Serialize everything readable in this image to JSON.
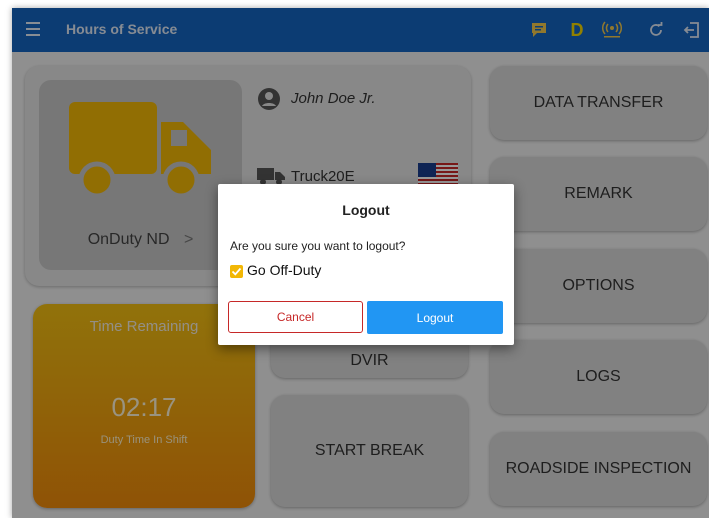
{
  "app": {
    "title": "Hours of Service"
  },
  "topbar_icons": [
    "menu-icon",
    "message-icon",
    "driving-status-icon",
    "eld-connection-icon",
    "refresh-icon",
    "logout-icon"
  ],
  "topbar": {
    "status_letter": "D"
  },
  "status_card": {
    "label": "OnDuty ND",
    "chevron": ">",
    "truck_icon": "truck-icon",
    "truck_color": "#f2b705"
  },
  "driver": {
    "name": "John Doe Jr.",
    "icon": "person-icon"
  },
  "vehicle": {
    "name": "Truck20E",
    "icon": "truck-icon",
    "flag_icon": "us-flag-icon"
  },
  "time_card": {
    "title": "Time Remaining",
    "value": "02:17",
    "subtitle": "Duty Time In Shift"
  },
  "middle_buttons": {
    "dvir": "DVIR",
    "start_break": "START BREAK"
  },
  "right_buttons": [
    "DATA TRANSFER",
    "REMARK",
    "OPTIONS",
    "LOGS",
    "ROADSIDE INSPECTION"
  ],
  "dialog": {
    "title": "Logout",
    "message": "Are you sure you want to logout?",
    "checkbox_label": "Go Off-Duty",
    "checkbox_checked": true,
    "cancel_label": "Cancel",
    "logout_label": "Logout"
  },
  "colors": {
    "topbar": "#1565c0",
    "accent_yellow": "#f2b705",
    "primary_button": "#2196f3",
    "cancel_border": "#c62828",
    "time_gradient_top": "#f2bf13",
    "time_gradient_bottom": "#ef8a0a"
  }
}
